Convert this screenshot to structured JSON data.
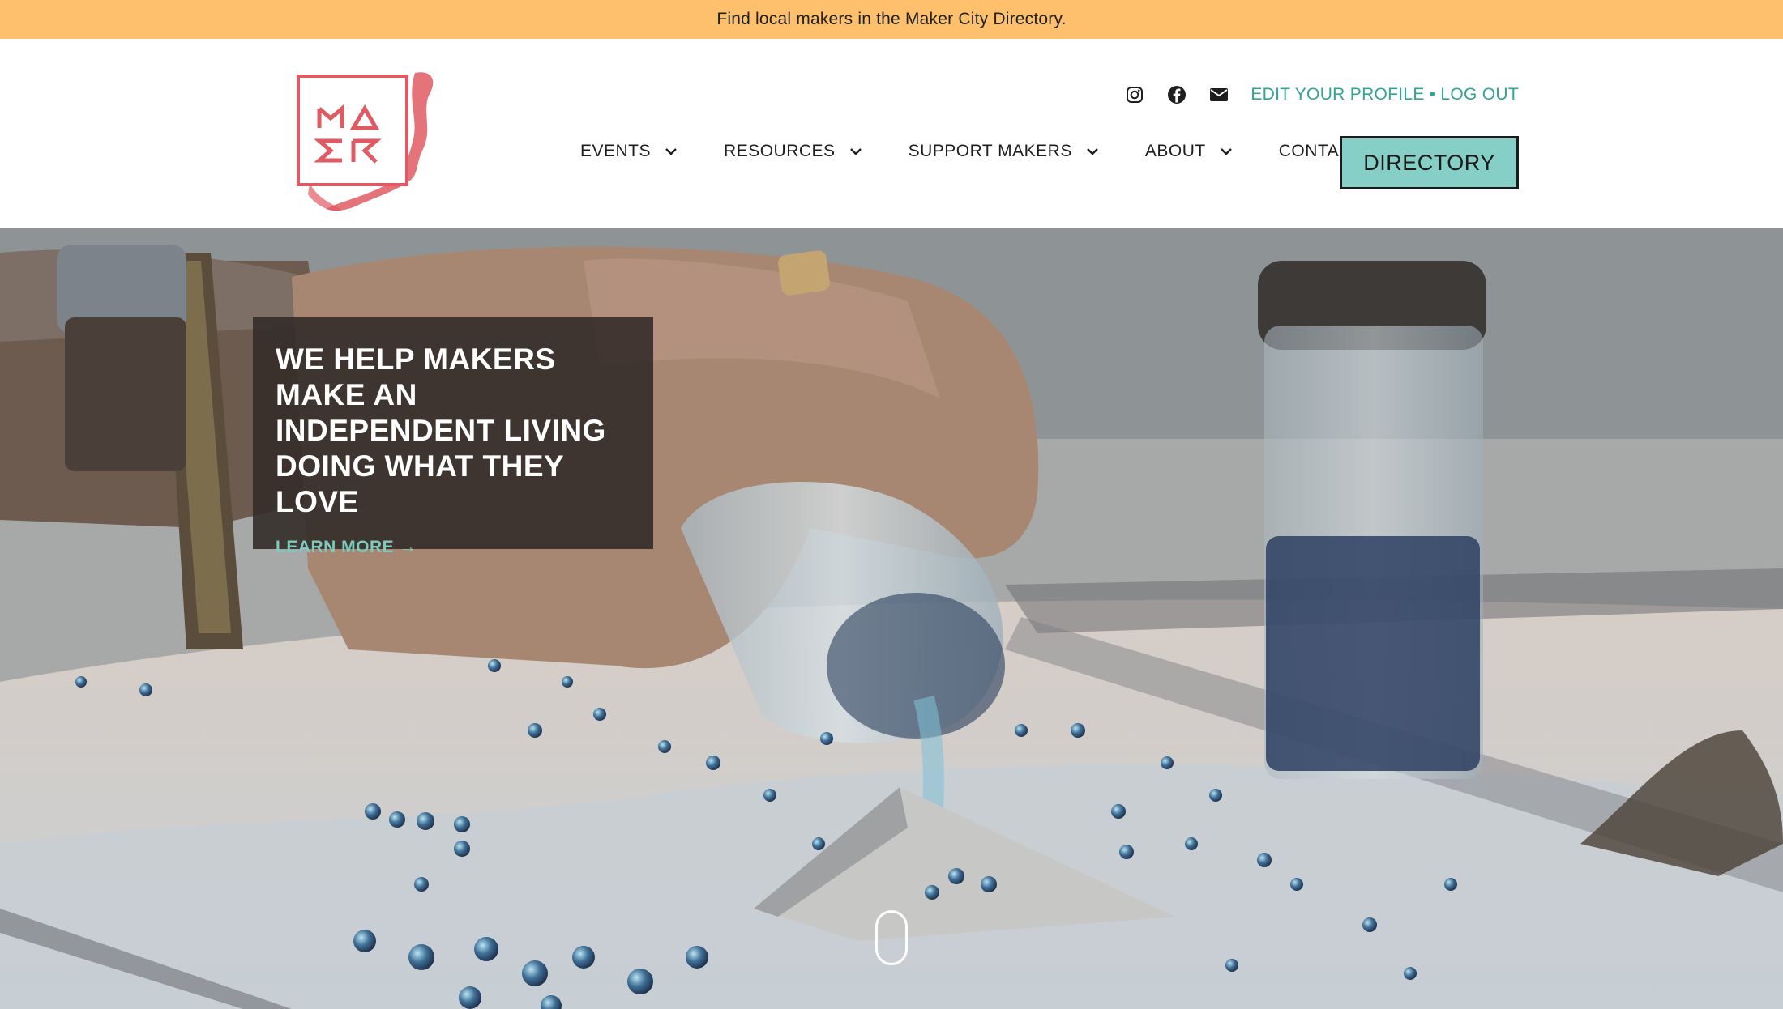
{
  "announcement": {
    "text": "Find local makers in the Maker City Directory."
  },
  "brand": {
    "logo_alt": "MAKR",
    "accent": "#e05a63"
  },
  "utility": {
    "social": [
      {
        "name": "instagram-icon"
      },
      {
        "name": "facebook-icon"
      },
      {
        "name": "email-icon"
      }
    ],
    "edit_profile": "EDIT YOUR PROFILE",
    "separator": "•",
    "log_out": "LOG OUT"
  },
  "nav": {
    "items": [
      {
        "label": "EVENTS",
        "has_dropdown": true
      },
      {
        "label": "RESOURCES",
        "has_dropdown": true
      },
      {
        "label": "SUPPORT MAKERS",
        "has_dropdown": true
      },
      {
        "label": "ABOUT",
        "has_dropdown": true
      },
      {
        "label": "CONTACT",
        "has_dropdown": false
      }
    ],
    "cta": "DIRECTORY"
  },
  "hero": {
    "headline": "WE HELP MAKERS MAKE AN INDEPENDENT LIVING DOING WHAT THEY LOVE",
    "link": "LEARN MORE →"
  },
  "colors": {
    "announcement_bg": "#fec06c",
    "link_teal": "#2fa593",
    "cta_bg": "#86cfc6",
    "hero_link": "#7ccbbf"
  }
}
